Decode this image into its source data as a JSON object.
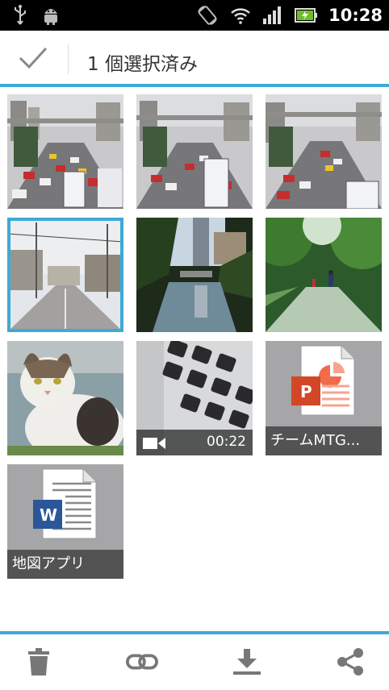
{
  "status_bar": {
    "time": "10:28",
    "icons": [
      "usb-icon",
      "android-debug-icon",
      "rotate-icon",
      "wifi-icon",
      "signal-icon",
      "battery-icon"
    ]
  },
  "action_bar": {
    "title": "1 個選択済み",
    "done_icon": "check-icon",
    "accent_color": "#3fa9d5"
  },
  "grid": {
    "items": [
      {
        "type": "photo",
        "subject": "traffic",
        "selected": false
      },
      {
        "type": "photo",
        "subject": "traffic",
        "selected": false
      },
      {
        "type": "photo",
        "subject": "traffic",
        "selected": false
      },
      {
        "type": "photo",
        "subject": "street",
        "selected": true
      },
      {
        "type": "photo",
        "subject": "canal",
        "selected": false
      },
      {
        "type": "photo",
        "subject": "park-path",
        "selected": false
      },
      {
        "type": "photo",
        "subject": "cat",
        "selected": false
      },
      {
        "type": "video",
        "subject": "keyboard",
        "duration": "00:22",
        "selected": false
      },
      {
        "type": "document",
        "app": "powerpoint",
        "caption": "チームMTG...",
        "icon_letter": "P",
        "selected": false
      },
      {
        "type": "document",
        "app": "word",
        "caption": "地図アプリ",
        "icon_letter": "W",
        "selected": false
      }
    ]
  },
  "bottom_bar": {
    "buttons": [
      "delete-icon",
      "link-icon",
      "download-icon",
      "share-icon"
    ]
  }
}
